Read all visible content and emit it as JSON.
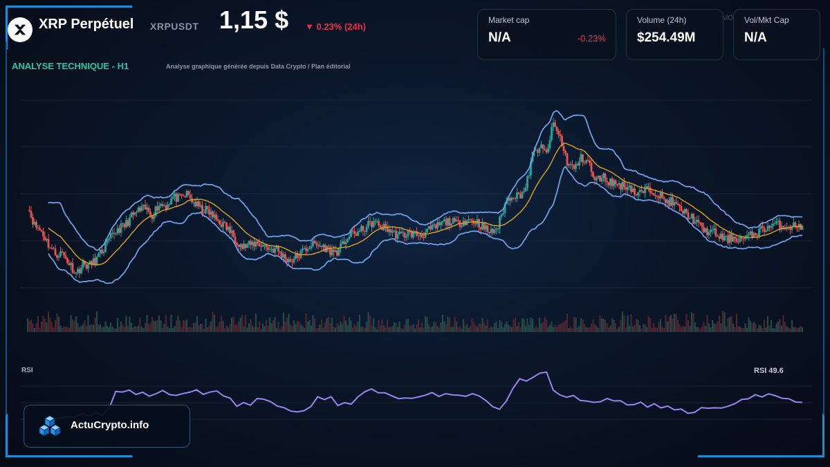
{
  "header": {
    "title": "XRP Perpétuel",
    "ticker": "XRPUSDT",
    "price": "1,15 $",
    "change": "▼ 0.23% (24h)",
    "section": "ANALYSE TECHNIQUE - H1",
    "subtitle": "Analyse graphique générée depuis Data Crypto / Plan éditorial",
    "ghost_text": "MO"
  },
  "cards": [
    {
      "label": "Market cap",
      "value": "N/A",
      "delta": "-0.23%"
    },
    {
      "label": "Volume (24h)",
      "value": "$254.49M"
    },
    {
      "label": "Vol/Mkt Cap",
      "value": "N/A"
    }
  ],
  "rsi": {
    "label": "RSI",
    "value_text": "RSI 49.6"
  },
  "brand": {
    "name": "ActuCrypto.info",
    "logo_icon": "cubes-icon"
  },
  "icons": {
    "coin": "xrp-logo-icon"
  },
  "colors": {
    "bull": "#26a69a",
    "bear": "#ef5350",
    "bollinger": "#6f9fe6",
    "ma": "#e0a51e",
    "rsi": "#9b85f0",
    "accent": "#22c9a4",
    "negative": "#e2344e"
  },
  "chart_data": {
    "type": "line",
    "title": "",
    "series": [
      {
        "name": "",
        "x": [
          0,
          10,
          20,
          30,
          40,
          50,
          60,
          70,
          80,
          90,
          100,
          110,
          120,
          130,
          140,
          150,
          160,
          170,
          180,
          190,
          200,
          210,
          220,
          230,
          240,
          250,
          260,
          270,
          280,
          290,
          300,
          310,
          320,
          330,
          340,
          350,
          360,
          370,
          380,
          390,
          400,
          410,
          420,
          430,
          440,
          450,
          460,
          470,
          480,
          490,
          500,
          510,
          520,
          530,
          540,
          550,
          560,
          570,
          580,
          590,
          600,
          610,
          620,
          630,
          640,
          650,
          660,
          670,
          680,
          690,
          700,
          710,
          720,
          730,
          740,
          750,
          760,
          770,
          780,
          790,
          800,
          810,
          820,
          830,
          840,
          850,
          860,
          870,
          880,
          890,
          900,
          910,
          920,
          930,
          940,
          950,
          960,
          970,
          980,
          990,
          1000,
          1010,
          1020,
          1030,
          1040,
          1050,
          1060,
          1070,
          1080,
          1090,
          1100,
          1110,
          1120
        ],
        "values": [
          1.143,
          1.113,
          1.104,
          1.084,
          1.069,
          1.07,
          1.055,
          1.04,
          1.053,
          1.052,
          1.062,
          1.077,
          1.094,
          1.107,
          1.112,
          1.126,
          1.135,
          1.138,
          1.129,
          1.145,
          1.143,
          1.156,
          1.153,
          1.16,
          1.148,
          1.138,
          1.135,
          1.124,
          1.116,
          1.107,
          1.093,
          1.08,
          1.082,
          1.086,
          1.083,
          1.077,
          1.076,
          1.065,
          1.059,
          1.065,
          1.075,
          1.084,
          1.082,
          1.079,
          1.072,
          1.074,
          1.092,
          1.1,
          1.103,
          1.111,
          1.118,
          1.111,
          1.108,
          1.1,
          1.097,
          1.101,
          1.099,
          1.099,
          1.105,
          1.11,
          1.117,
          1.119,
          1.115,
          1.12,
          1.121,
          1.118,
          1.108,
          1.102,
          1.111,
          1.145,
          1.16,
          1.158,
          1.169,
          1.22,
          1.232,
          1.222,
          1.268,
          1.246,
          1.21,
          1.198,
          1.215,
          1.212,
          1.179,
          1.188,
          1.18,
          1.177,
          1.173,
          1.173,
          1.16,
          1.164,
          1.168,
          1.163,
          1.15,
          1.149,
          1.14,
          1.132,
          1.125,
          1.113,
          1.104,
          1.103,
          1.096,
          1.091,
          1.095,
          1.092,
          1.094,
          1.1,
          1.106,
          1.11,
          1.114,
          1.113,
          1.111,
          1.112,
          1.112
        ]
      }
    ],
    "rsi_values": [
      38,
      38,
      39,
      40,
      40,
      41,
      41,
      42,
      42,
      44,
      58,
      59,
      60,
      56,
      57,
      56,
      58,
      60,
      57,
      57,
      58,
      57,
      59,
      57,
      58,
      60,
      56,
      54,
      47,
      49,
      49,
      53,
      52,
      52,
      47,
      45,
      44,
      43,
      44,
      47,
      53,
      52,
      53,
      49,
      51,
      50,
      53,
      58,
      59,
      58,
      57,
      54,
      52,
      53,
      54,
      53,
      56,
      57,
      55,
      56,
      57,
      55,
      56,
      57,
      55,
      53,
      47,
      45,
      51,
      62,
      68,
      66,
      70,
      71,
      73,
      60,
      56,
      55,
      54,
      53,
      52,
      51,
      52,
      52,
      51,
      50,
      48,
      47,
      49,
      48,
      49,
      46,
      47,
      45,
      44,
      43,
      44,
      45,
      46,
      45,
      46,
      47,
      49,
      51,
      53,
      55,
      54,
      56,
      55,
      53,
      52,
      50,
      51
    ],
    "rsi_latest": 49.6,
    "ylim": [
      0.95,
      1.33
    ],
    "grid": true
  }
}
